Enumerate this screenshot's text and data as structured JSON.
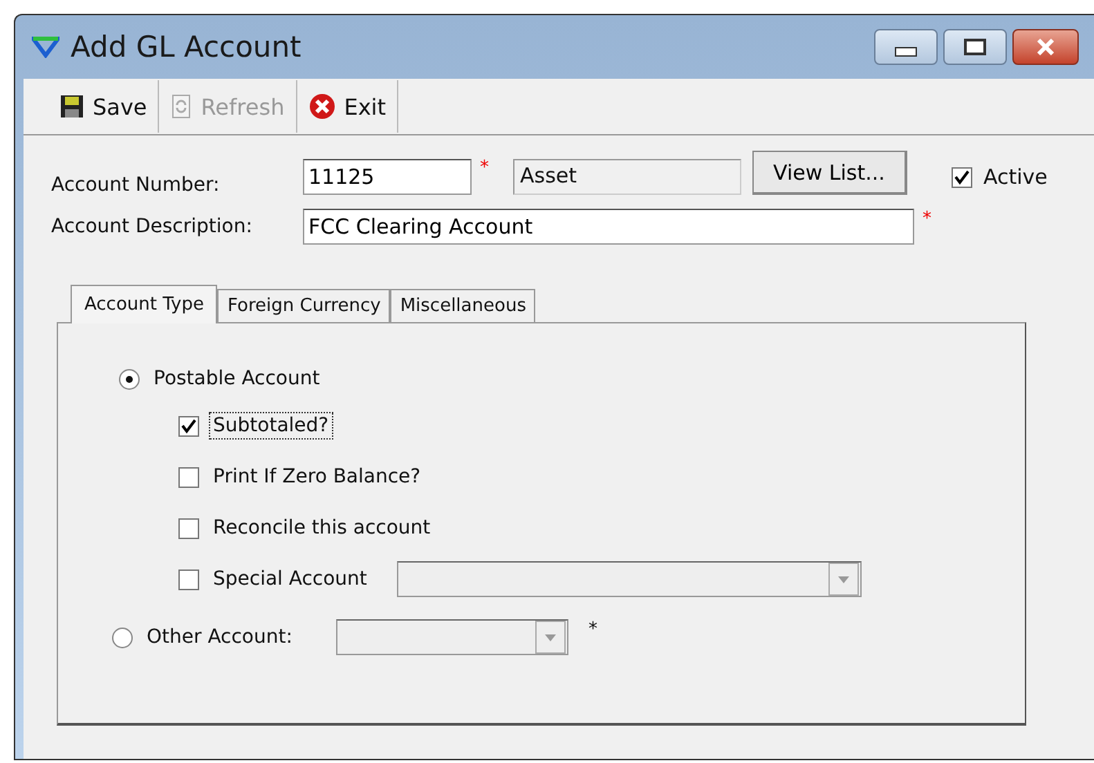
{
  "window": {
    "title": "Add GL Account"
  },
  "toolbar": [
    {
      "label": "Save",
      "kind": "save",
      "disabled": false
    },
    {
      "label": "Refresh",
      "kind": "refresh",
      "disabled": true
    },
    {
      "label": "Exit",
      "kind": "exit",
      "disabled": false
    }
  ],
  "account_number": {
    "label": "Account Number:",
    "value": "11125",
    "required_mark": "*",
    "type_value": "Asset"
  },
  "view_list_button": "View List...",
  "active": {
    "label": "Active",
    "checked": true
  },
  "account_description": {
    "label": "Account Description:",
    "value": "FCC Clearing Account",
    "required_mark": "*"
  },
  "tabs": [
    {
      "label": "Account Type",
      "selected": true
    },
    {
      "label": "Foreign Currency",
      "selected": false
    },
    {
      "label": "Miscellaneous",
      "selected": false
    }
  ],
  "postable": {
    "label": "Postable Account",
    "selected": true
  },
  "options": [
    {
      "label": "Subtotaled?",
      "checked": true,
      "focused": true
    },
    {
      "label": "Print If Zero Balance?",
      "checked": false,
      "focused": false
    },
    {
      "label": "Reconcile this account",
      "checked": false,
      "focused": false
    },
    {
      "label": "Special Account",
      "checked": false,
      "focused": false,
      "has_dropdown": true
    }
  ],
  "other": {
    "label": "Other Account:",
    "selected": false,
    "required_mark": "*"
  }
}
